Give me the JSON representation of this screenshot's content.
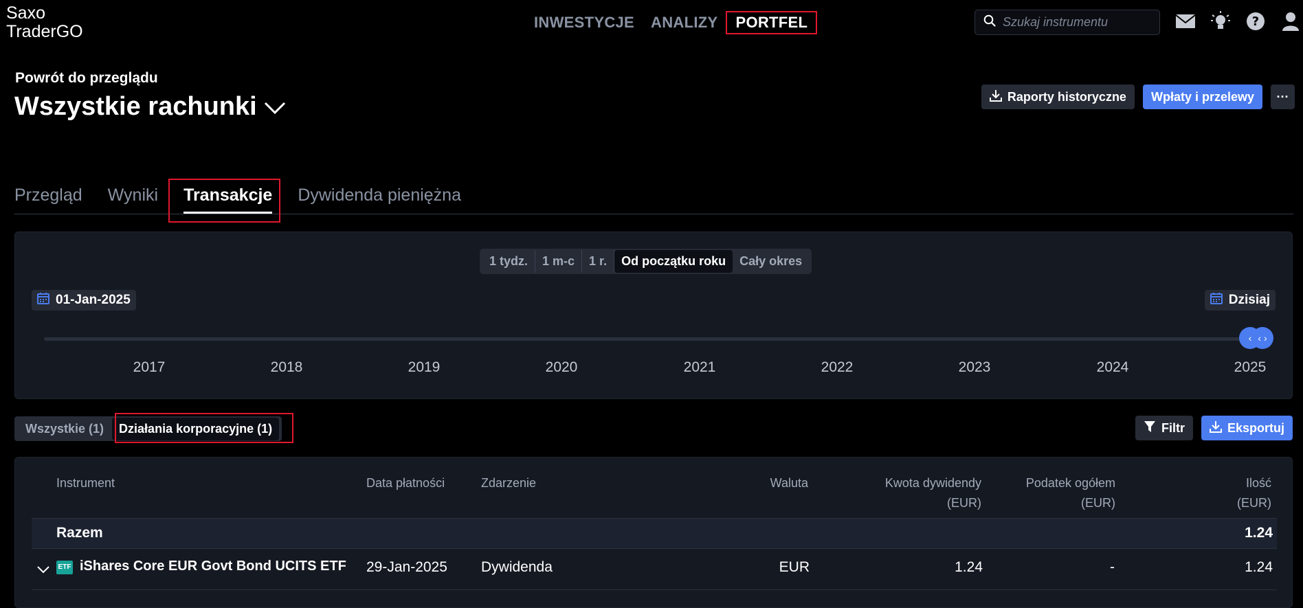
{
  "app": {
    "logo_line1": "Saxo",
    "logo_line2": "TraderGO"
  },
  "topnav": [
    {
      "label": "INWESTYCJE",
      "active": false
    },
    {
      "label": "ANALIZY",
      "active": false
    },
    {
      "label": "PORTFEL",
      "active": true
    }
  ],
  "search": {
    "placeholder": "Szukaj instrumentu"
  },
  "top_icons": [
    "mail-icon",
    "lightbulb-icon",
    "help-icon",
    "user-icon"
  ],
  "header": {
    "back_label": "Powrót do przeglądu",
    "account_label": "Wszystkie rachunki",
    "reports_button": "Raporty historyczne",
    "payments_button": "Wpłaty i przelewy",
    "more_button": "···"
  },
  "tabs": [
    {
      "label": "Przegląd",
      "active": false
    },
    {
      "label": "Wyniki",
      "active": false
    },
    {
      "label": "Transakcje",
      "active": true
    },
    {
      "label": "Dywidenda pieniężna",
      "active": false
    }
  ],
  "periods": [
    {
      "label": "1 tydz.",
      "active": false
    },
    {
      "label": "1 m-c",
      "active": false
    },
    {
      "label": "1 r.",
      "active": false
    },
    {
      "label": "Od początku roku",
      "active": true
    },
    {
      "label": "Cały okres",
      "active": false
    }
  ],
  "timeline": {
    "start_date": "01-Jan-2025",
    "end_date": "Dzisiaj",
    "years": [
      "2017",
      "2018",
      "2019",
      "2020",
      "2021",
      "2022",
      "2023",
      "2024",
      "2025"
    ],
    "handle_left": "‹",
    "handle_right": "‹ ›"
  },
  "subtabs": [
    {
      "label": "Wszystkie (1)",
      "active": false
    },
    {
      "label": "Działania korporacyjne (1)",
      "active": true
    }
  ],
  "actions": {
    "filter_label": "Filtr",
    "export_label": "Eksportuj"
  },
  "table": {
    "headers": {
      "instrument": "Instrument",
      "payment_date": "Data płatności",
      "event": "Zdarzenie",
      "currency": "Waluta",
      "dividend_amount": "Kwota dywidendy",
      "dividend_amount_unit": "(EUR)",
      "total_tax": "Podatek ogółem",
      "total_tax_unit": "(EUR)",
      "quantity": "Ilość",
      "quantity_unit": "(EUR)"
    },
    "total": {
      "label": "Razem",
      "quantity": "1.24"
    },
    "rows": [
      {
        "badge": "ETF",
        "instrument": "iShares Core EUR Govt Bond UCITS ETF",
        "payment_date": "29-Jan-2025",
        "event": "Dywidenda",
        "currency": "EUR",
        "dividend_amount": "1.24",
        "total_tax": "-",
        "quantity": "1.24"
      }
    ]
  },
  "colors": {
    "accent_blue": "#4b7cf0",
    "highlight_red": "#e0182d",
    "etf_badge": "#17a398"
  }
}
